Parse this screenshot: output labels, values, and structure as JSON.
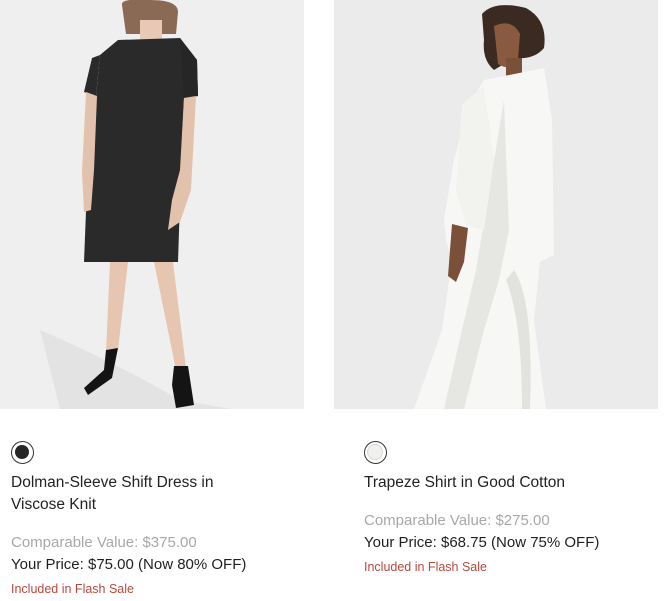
{
  "products": [
    {
      "title": "Dolman-Sleeve Shift Dress in Viscose Knit",
      "comparable": "Comparable Value: $375.00",
      "price": "Your Price: $75.00 (Now 80% OFF)",
      "sale_note": "Included in Flash Sale",
      "swatch_color": "#262626",
      "image_icon": "product-photo"
    },
    {
      "title": "Trapeze Shirt in Good Cotton",
      "comparable": "Comparable Value: $275.00",
      "price": "Your Price: $68.75 (Now 75% OFF)",
      "sale_note": "Included in Flash Sale",
      "swatch_color": "#f0f0ee",
      "image_icon": "product-photo"
    }
  ],
  "colors": {
    "sale_note": "#b84a3e",
    "comparable": "#a8a8a8"
  }
}
